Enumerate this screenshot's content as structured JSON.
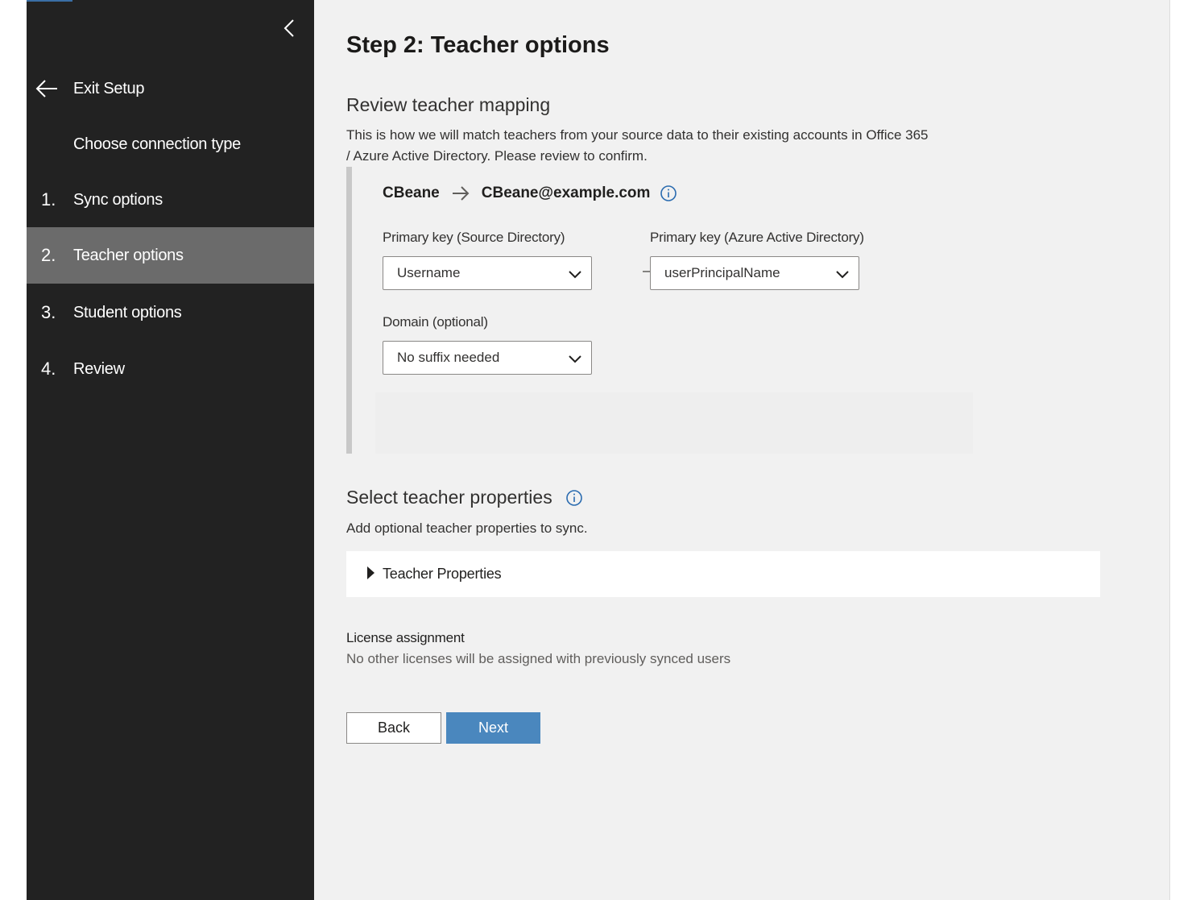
{
  "sidebar": {
    "collapse_icon": "chevron-left-icon",
    "exit_label": "Exit Setup",
    "items": [
      {
        "num": "",
        "label": "Choose connection type",
        "active": false
      },
      {
        "num": "1.",
        "label": "Sync options",
        "active": false
      },
      {
        "num": "2.",
        "label": "Teacher options",
        "active": true
      },
      {
        "num": "3.",
        "label": "Student options",
        "active": false
      },
      {
        "num": "4.",
        "label": "Review",
        "active": false
      }
    ]
  },
  "main": {
    "title": "Step 2: Teacher options",
    "mapping": {
      "heading": "Review teacher mapping",
      "description_line1": "This is how we will match teachers from your source data to their existing accounts in Office 365",
      "description_line2": "/ Azure Active Directory. Please review to confirm.",
      "example_source": "CBeane",
      "example_target": "CBeane@example.com",
      "source_key_label": "Primary key (Source Directory)",
      "source_key_value": "Username",
      "target_key_label": "Primary key (Azure Active Directory)",
      "target_key_value": "userPrincipalName",
      "domain_label": "Domain (optional)",
      "domain_value": "No suffix needed"
    },
    "properties": {
      "heading": "Select teacher properties",
      "description": "Add optional teacher properties to sync.",
      "accordion_label": "Teacher Properties"
    },
    "license": {
      "title": "License assignment",
      "subtitle": "No other licenses will be assigned with previously synced users"
    },
    "buttons": {
      "back": "Back",
      "next": "Next"
    }
  },
  "colors": {
    "sidebar_bg": "#222222",
    "active_item_bg": "#6b6b6b",
    "main_bg": "#f1f1f1",
    "primary_button": "#4a87be",
    "info_icon": "#2b6cb0"
  }
}
